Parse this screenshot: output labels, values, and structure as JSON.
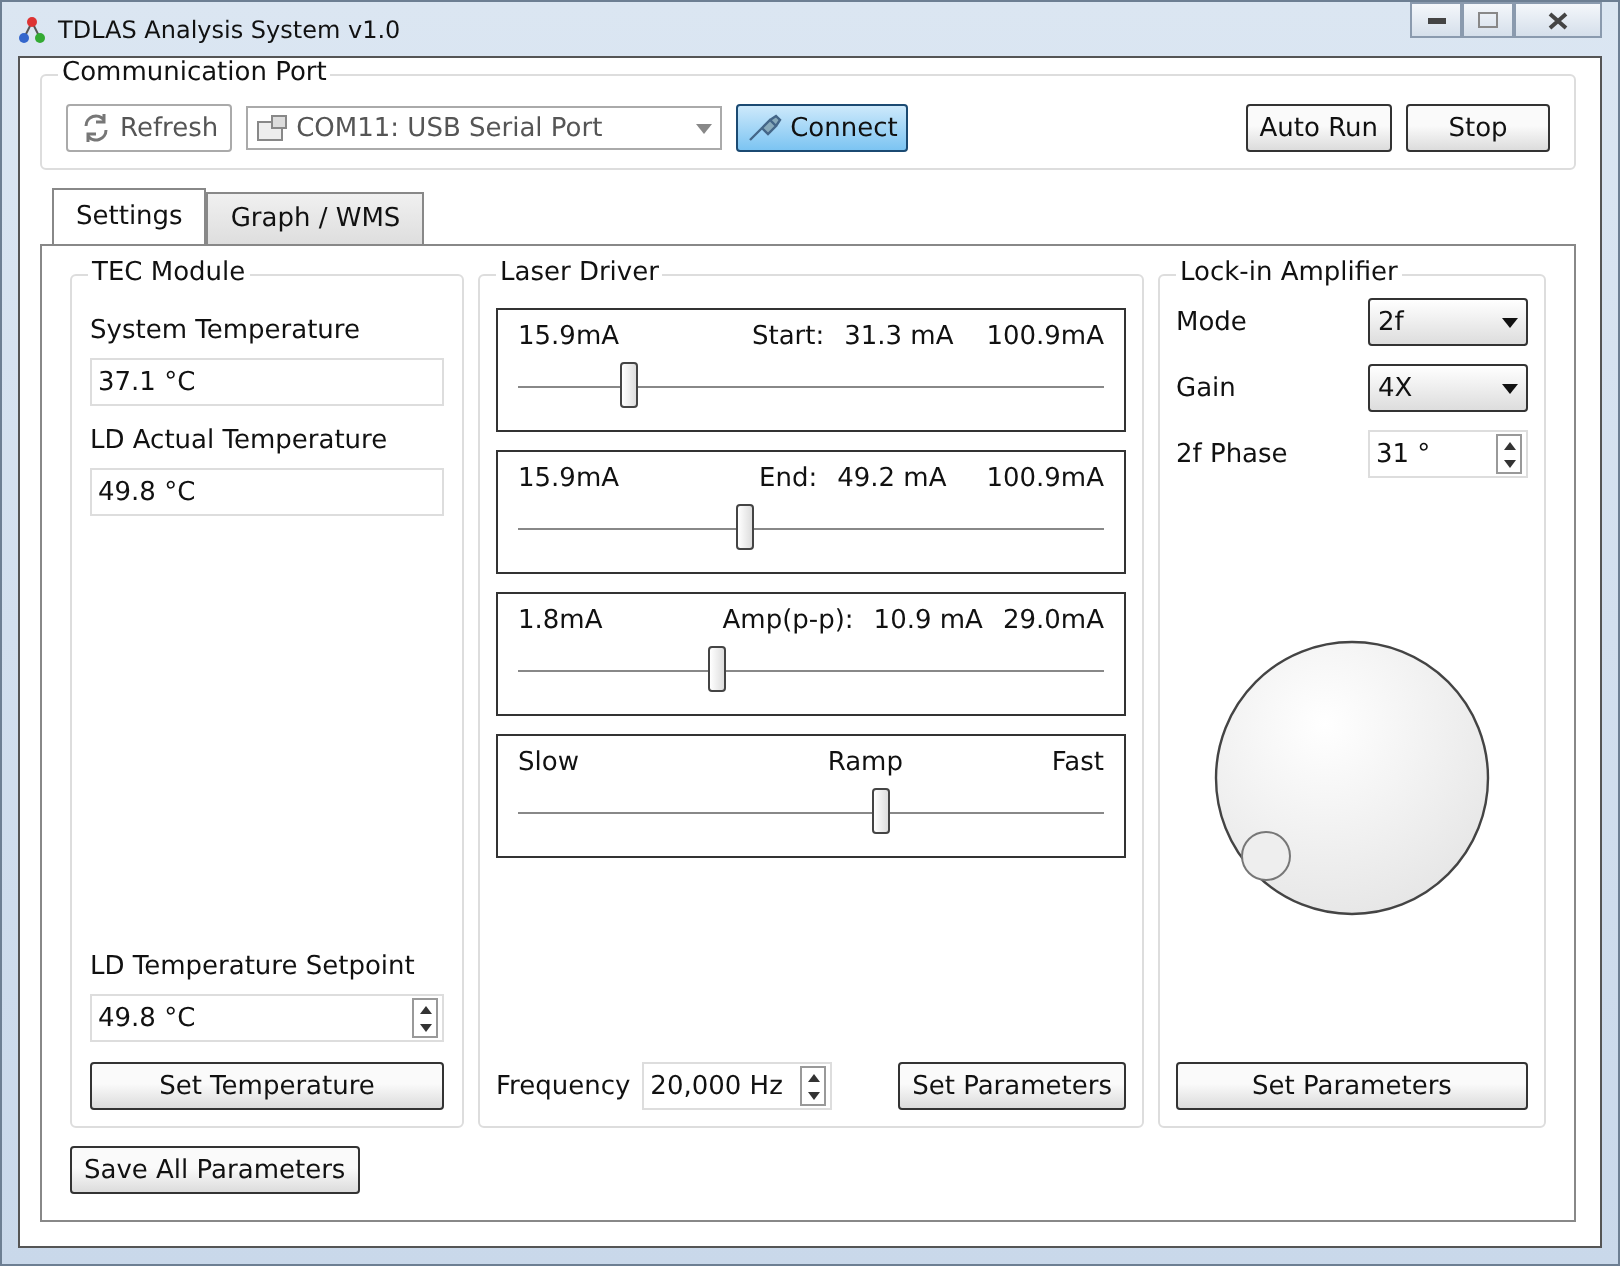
{
  "window": {
    "title": "TDLAS Analysis System v1.0"
  },
  "communication_port": {
    "title": "Communication Port",
    "refresh": "Refresh",
    "port": "COM11: USB Serial Port",
    "connect": "Connect",
    "auto_run": "Auto Run",
    "stop": "Stop"
  },
  "tabs": [
    {
      "label": "Settings",
      "selected": true
    },
    {
      "label": "Graph / WMS",
      "selected": false
    }
  ],
  "tec_module": {
    "title": "TEC Module",
    "readings": [
      {
        "label": "System Temperature",
        "value": "37.1 °C"
      },
      {
        "label": "LD Actual Temperature",
        "value": "49.8 °C"
      }
    ],
    "setpoint": {
      "label": "LD Temperature Setpoint",
      "value": "49.8 °C"
    },
    "button": "Set Temperature"
  },
  "laser_driver": {
    "title": "Laser Driver",
    "sliders": [
      {
        "min": "15.9mA",
        "label": "Start:",
        "value": "31.3 mA",
        "max": "100.9mA",
        "level": 0.19
      },
      {
        "min": "15.9mA",
        "label": "End:",
        "value": "49.2 mA",
        "max": "100.9mA",
        "level": 0.39
      },
      {
        "min": "1.8mA",
        "label": "Amp(p-p):",
        "value": "10.9 mA",
        "max": "29.0mA",
        "level": 0.34
      },
      {
        "min": "Slow",
        "label": "Ramp",
        "max": "Fast",
        "level": 0.62
      }
    ],
    "frequency": {
      "label": "Frequency",
      "value": "20,000 Hz"
    },
    "button": "Set Parameters"
  },
  "lock_in_amplifier": {
    "title": "Lock-in Amplifier",
    "rows": [
      {
        "kind": "select",
        "label": "Mode",
        "value": "2f"
      },
      {
        "kind": "select",
        "label": "Gain",
        "value": "4X"
      },
      {
        "kind": "spin",
        "label": "2f Phase",
        "value": "31 °"
      }
    ],
    "button": "Set Parameters"
  },
  "save_button": "Save All Parameters"
}
